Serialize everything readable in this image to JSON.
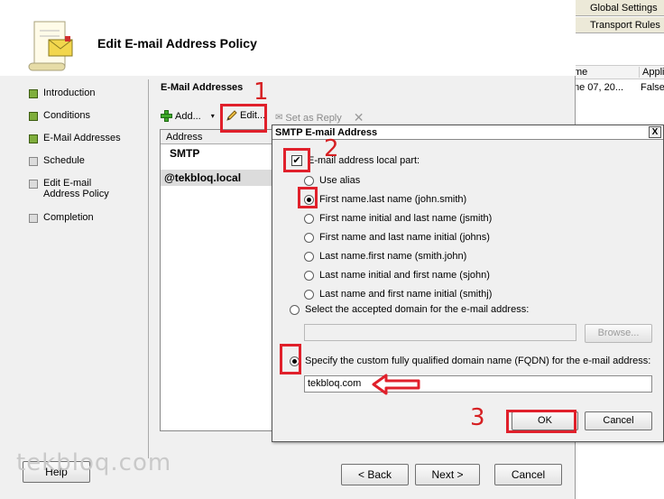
{
  "background_console": {
    "tabs": [
      "Global Settings",
      "Transport Rules"
    ],
    "columns": [
      "me",
      "Appli"
    ],
    "row": [
      "ne 07, 20...",
      "False"
    ]
  },
  "wizard": {
    "title": "Edit E-mail Address Policy",
    "nav": [
      {
        "label": "Introduction",
        "state": "done"
      },
      {
        "label": "Conditions",
        "state": "done"
      },
      {
        "label": "E-Mail Addresses",
        "state": "done"
      },
      {
        "label": "Schedule",
        "state": "todo"
      },
      {
        "label": "Edit E-mail Address Policy",
        "state": "todo"
      },
      {
        "label": "Completion",
        "state": "todo"
      }
    ],
    "section_title": "E-Mail Addresses",
    "toolbar": {
      "add": "Add...",
      "edit": "Edit...",
      "set_reply": "Set as Reply"
    },
    "list": {
      "header": "Address",
      "rows": [
        "SMTP",
        "@tekbloq.local"
      ]
    },
    "buttons": {
      "help": "Help",
      "back": "< Back",
      "next": "Next >",
      "cancel": "Cancel"
    }
  },
  "dialog": {
    "title": "SMTP E-mail Address",
    "close": "X",
    "local_part_label": "E-mail address local part:",
    "local_part_checked": true,
    "local_part_options": [
      {
        "label": "Use alias",
        "selected": false
      },
      {
        "label": "First name.last name (john.smith)",
        "selected": true
      },
      {
        "label": "First name initial and last name (jsmith)",
        "selected": false
      },
      {
        "label": "First name and last name initial (johns)",
        "selected": false
      },
      {
        "label": "Last name.first name (smith.john)",
        "selected": false
      },
      {
        "label": "Last name initial and first name (sjohn)",
        "selected": false
      },
      {
        "label": "Last name and first name initial (smithj)",
        "selected": false
      }
    ],
    "accepted_domain_label": "Select the accepted domain for the e-mail address:",
    "accepted_domain_value": "",
    "browse": "Browse...",
    "fqdn_label": "Specify the custom fully qualified domain name (FQDN) for the e-mail address:",
    "fqdn_value": "tekbloq.com",
    "ok": "OK",
    "cancel": "Cancel"
  },
  "annotations": {
    "n1": "1",
    "n2": "2",
    "n3": "3"
  },
  "watermark": "tekbloq.com",
  "colors": {
    "annotation_red": "#e0202b",
    "nav_done": "#7fae3c"
  }
}
